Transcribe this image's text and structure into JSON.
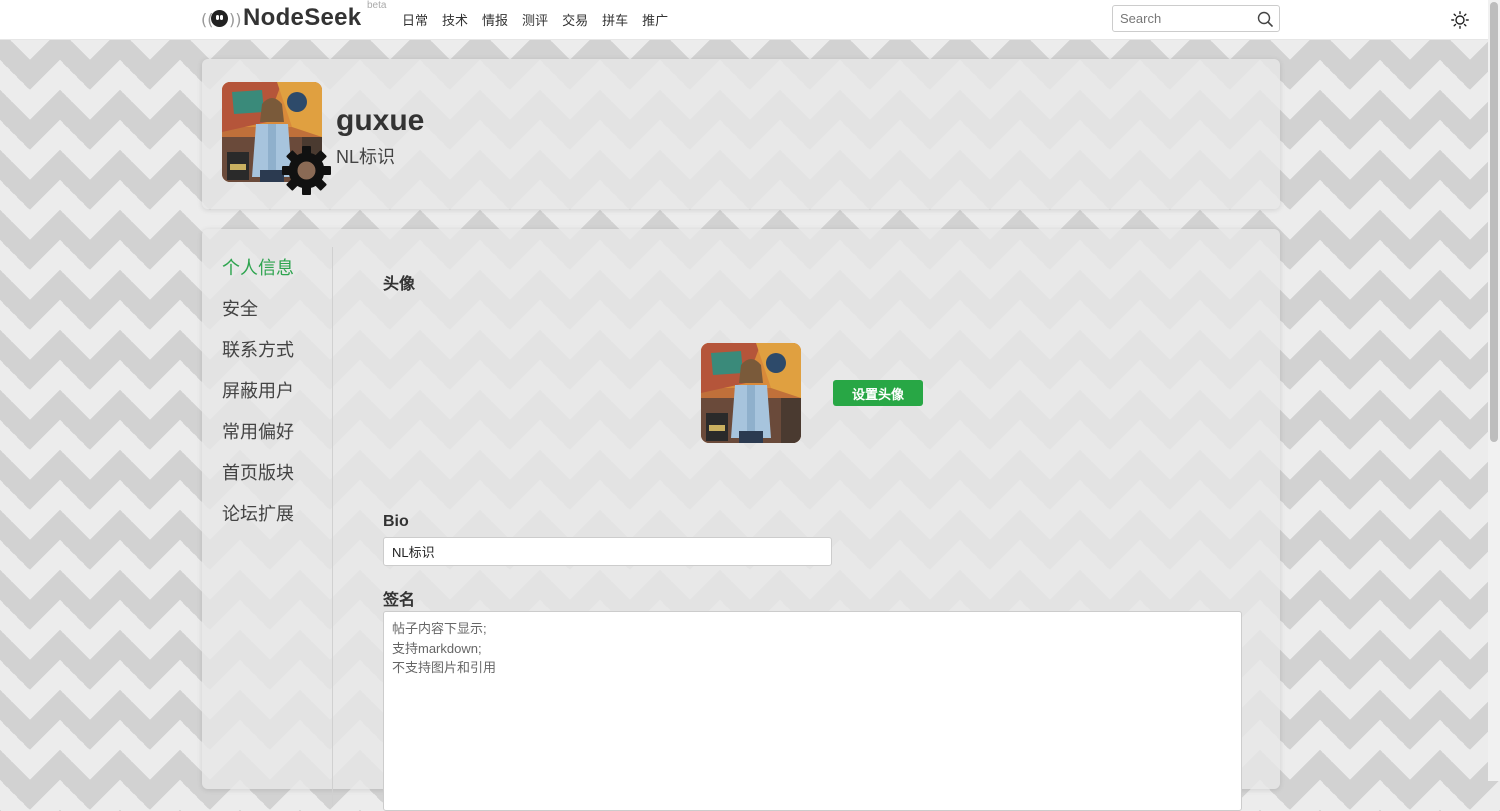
{
  "header": {
    "logo_text": "NodeSeek",
    "logo_badge": "beta",
    "nav": [
      "日常",
      "技术",
      "情报",
      "测评",
      "交易",
      "拼车",
      "推广"
    ],
    "search_placeholder": "Search"
  },
  "profile": {
    "username": "guxue",
    "bio": "NL标识"
  },
  "settings": {
    "menu": [
      "个人信息",
      "安全",
      "联系方式",
      "屏蔽用户",
      "常用偏好",
      "首页版块",
      "论坛扩展"
    ],
    "active_menu": "个人信息",
    "avatar_label": "头像",
    "set_avatar_button": "设置头像",
    "bio_label": "Bio",
    "bio_value": "NL标识",
    "signature_label": "签名",
    "signature_placeholder": "帖子内容下显示;\n支持markdown;\n不支持图片和引用"
  },
  "colors": {
    "accent_green": "#2ea44f",
    "button_green": "#28a745"
  },
  "icons": {
    "search": "search-icon",
    "theme": "sun-icon",
    "settings": "gear-icon"
  }
}
